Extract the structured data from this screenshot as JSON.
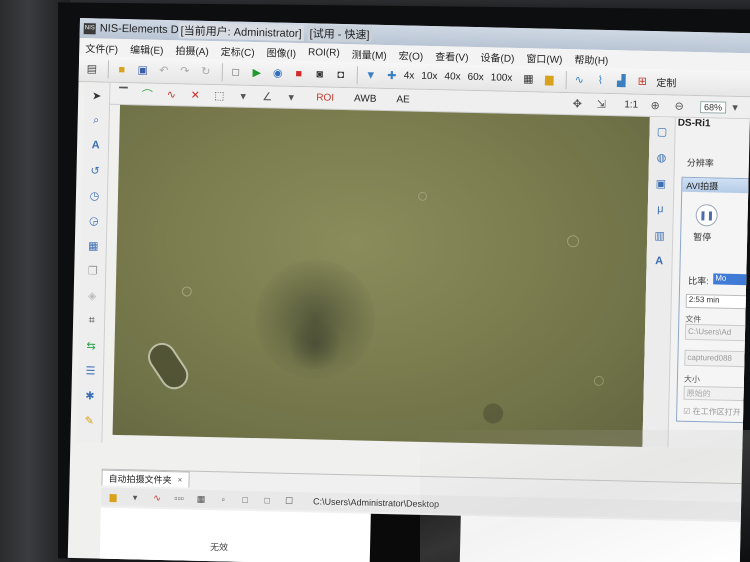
{
  "window": {
    "title": "NIS-Elements D",
    "user": "[当前用户: Administrator]",
    "trial": "[试用 - 快速]"
  },
  "menu": [
    "文件(F)",
    "编辑(E)",
    "拍摄(A)",
    "定标(C)",
    "图像(I)",
    "ROI(R)",
    "测量(M)",
    "宏(O)",
    "查看(V)",
    "设备(D)",
    "窗口(W)",
    "帮助(H)"
  ],
  "toolbar": {
    "zoom_levels": [
      "4x",
      "10x",
      "40x",
      "60x",
      "100x"
    ],
    "customize_label": "定制"
  },
  "toolbar2": {
    "roi_label": "ROI",
    "awb_label": "AWB",
    "ae_label": "AE",
    "ratio_label": "1:1",
    "zoom_percent": "68%"
  },
  "right_panel": {
    "title": "DS-Ri1",
    "resolution_label": "分辨率"
  },
  "avi_dialog": {
    "title": "AVI拍摄",
    "pause_label": "暂停",
    "compression_label": "比率:",
    "compression_value": "Mo",
    "time_value": "2:53 min",
    "file_label": "文件",
    "path_value": "C:\\Users\\Ad",
    "name_value": "captured088",
    "size_label": "大小",
    "size_value": "原始的",
    "doc_option": "在工作区打开"
  },
  "bottom_panel": {
    "tab_label": "自动拍摄文件夹",
    "tab_close": "×",
    "path": "C:\\Users\\Administrator\\Desktop",
    "empty_label": "无效"
  },
  "colors": {
    "micrograph_bg": "#7b7d4f",
    "accent_blue": "#3f7ad6",
    "title_bar": "#b9c5d4"
  }
}
